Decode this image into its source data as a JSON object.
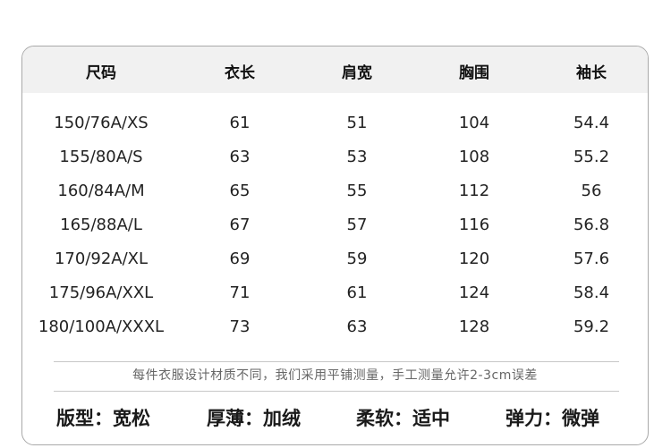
{
  "table": {
    "headers": [
      "尺码",
      "衣长",
      "肩宽",
      "胸围",
      "袖长"
    ],
    "rows": [
      [
        "150/76A/XS",
        "61",
        "51",
        "104",
        "54.4"
      ],
      [
        "155/80A/S",
        "63",
        "53",
        "108",
        "55.2"
      ],
      [
        "160/84A/M",
        "65",
        "55",
        "112",
        "56"
      ],
      [
        "165/88A/L",
        "67",
        "57",
        "116",
        "56.8"
      ],
      [
        "170/92A/XL",
        "69",
        "59",
        "120",
        "57.6"
      ],
      [
        "175/96A/XXL",
        "71",
        "61",
        "124",
        "58.4"
      ],
      [
        "180/100A/XXXL",
        "73",
        "63",
        "128",
        "59.2"
      ]
    ]
  },
  "note": "每件衣服设计材质不同，我们采用平铺测量，手工测量允许2-3cm误差",
  "properties": [
    {
      "label": "版型：",
      "value": "宽松"
    },
    {
      "label": "厚薄：",
      "value": "加绒"
    },
    {
      "label": "柔软：",
      "value": "适中"
    },
    {
      "label": "弹力：",
      "value": "微弹"
    }
  ]
}
